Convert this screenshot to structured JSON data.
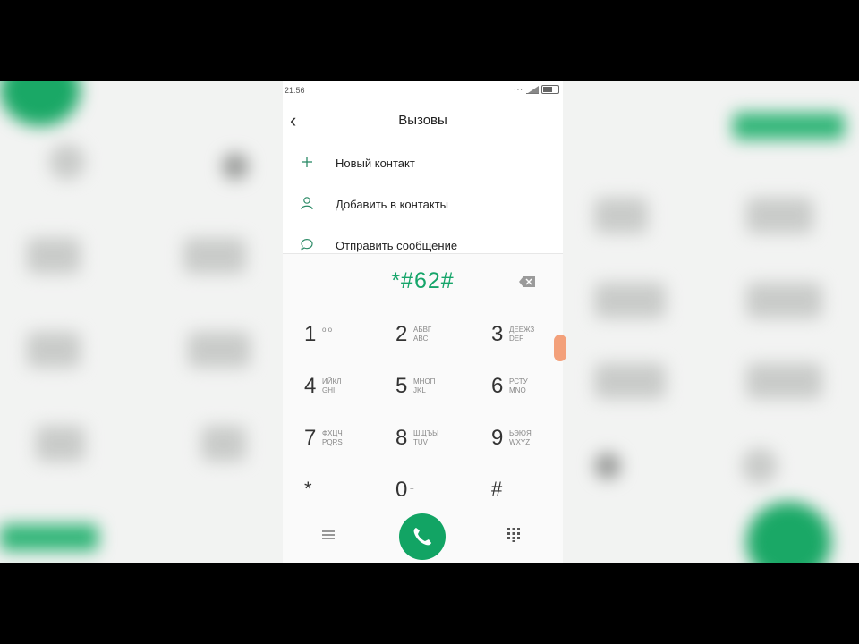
{
  "status_bar": {
    "time": "21:56"
  },
  "header": {
    "title": "Вызовы"
  },
  "menu": [
    {
      "label": "Новый контакт",
      "icon": "plus-icon"
    },
    {
      "label": "Добавить в контакты",
      "icon": "person-icon"
    },
    {
      "label": "Отправить сообщение",
      "icon": "message-icon"
    }
  ],
  "dialer": {
    "display": "*#62#",
    "keys": [
      {
        "digit": "1",
        "sub1": "o.o",
        "sub2": ""
      },
      {
        "digit": "2",
        "sub1": "АБВГ",
        "sub2": "ABC"
      },
      {
        "digit": "3",
        "sub1": "ДЕЁЖЗ",
        "sub2": "DEF"
      },
      {
        "digit": "4",
        "sub1": "ИЙКЛ",
        "sub2": "GHI"
      },
      {
        "digit": "5",
        "sub1": "МНОП",
        "sub2": "JKL"
      },
      {
        "digit": "6",
        "sub1": "РСТУ",
        "sub2": "MNO"
      },
      {
        "digit": "7",
        "sub1": "ФХЦЧ",
        "sub2": "PQRS"
      },
      {
        "digit": "8",
        "sub1": "ШЩЪЫ",
        "sub2": "TUV"
      },
      {
        "digit": "9",
        "sub1": "ЬЭЮЯ",
        "sub2": "WXYZ"
      },
      {
        "digit": "*",
        "sub1": "",
        "sub2": ""
      },
      {
        "digit": "0",
        "sub1": "+",
        "sub2": ""
      },
      {
        "digit": "#",
        "sub1": "",
        "sub2": ""
      }
    ]
  },
  "colors": {
    "accent": "#12a464",
    "display_text": "#16a56a"
  }
}
